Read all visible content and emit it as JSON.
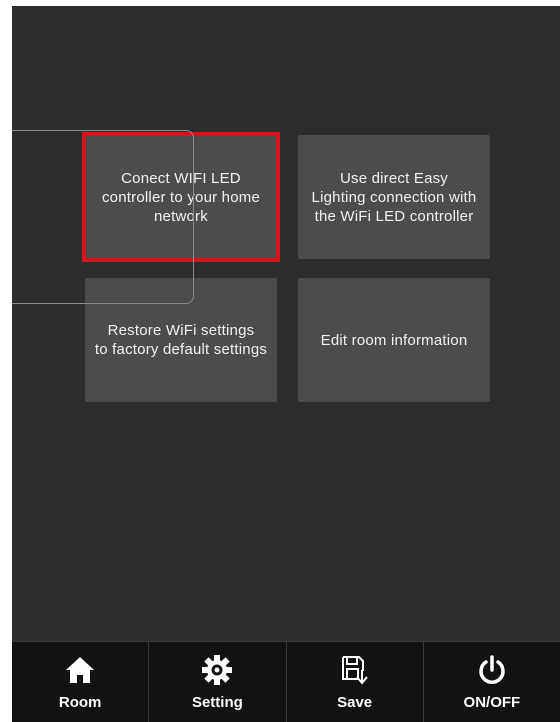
{
  "tiles": [
    {
      "label": "Conect WIFI LED\ncontroller to your home\nnetwork",
      "selected": true
    },
    {
      "label": "Use direct Easy\nLighting connection with\nthe WiFi LED controller",
      "selected": false
    },
    {
      "label": "Restore WiFi settings\nto factory default settings",
      "selected": false
    },
    {
      "label": "Edit room information",
      "selected": false
    }
  ],
  "nav": [
    {
      "label": "Room",
      "icon": "home-icon"
    },
    {
      "label": "Setting",
      "icon": "gear-icon"
    },
    {
      "label": "Save",
      "icon": "save-icon"
    },
    {
      "label": "ON/OFF",
      "icon": "power-icon"
    }
  ],
  "colors": {
    "background": "#2b2d2e",
    "tile": "#4a4c4e",
    "selected_border": "#d4161b",
    "bottom_bar": "#121212"
  }
}
